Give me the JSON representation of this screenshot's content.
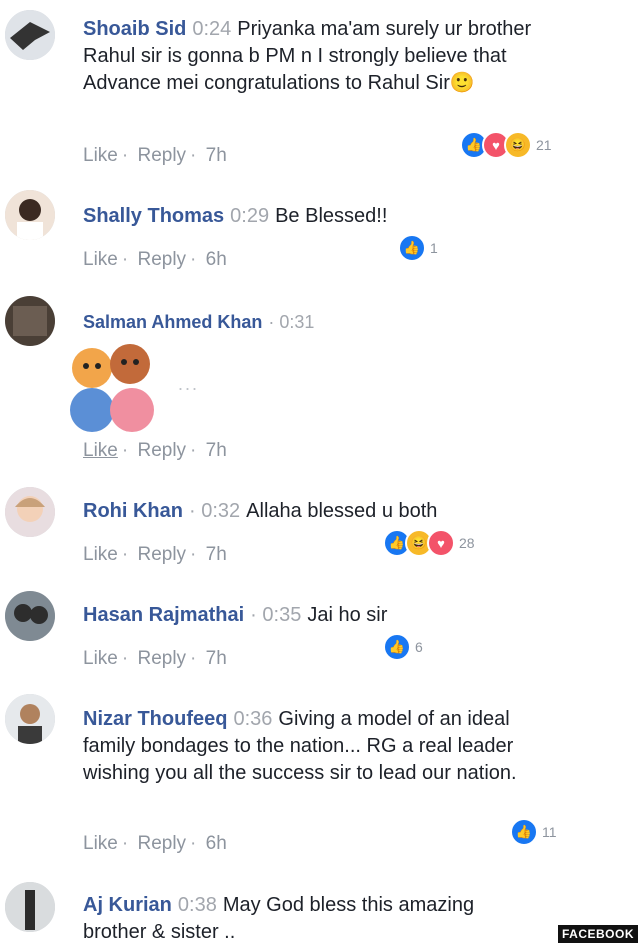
{
  "comments": [
    {
      "name": "Shoaib Sid",
      "time": "0:24",
      "text": "Priyanka ma'am surely ur brother Rahul sir is gonna b PM n I strongly believe that Advance mei congratulations to Rahul Sir🙂",
      "like": "Like",
      "reply": "Reply",
      "ago": "7h",
      "reaction_count": "21"
    },
    {
      "name": "Shally Thomas",
      "time": "0:29",
      "text": "Be Blessed!!",
      "like": "Like",
      "reply": "Reply",
      "ago": "6h",
      "reaction_count": "1"
    },
    {
      "name": "Salman Ahmed Khan",
      "time": "0:31",
      "text": "",
      "like": "Like",
      "reply": "Reply",
      "ago": "7h",
      "reaction_count": ""
    },
    {
      "name": "Rohi Khan",
      "time": "0:32",
      "text": "Allaha blessed u both",
      "like": "Like",
      "reply": "Reply",
      "ago": "7h",
      "reaction_count": "28"
    },
    {
      "name": "Hasan Rajmathai",
      "time": "0:35",
      "text": "Jai ho sir",
      "like": "Like",
      "reply": "Reply",
      "ago": "7h",
      "reaction_count": "6"
    },
    {
      "name": "Nizar Thoufeeq",
      "time": "0:36",
      "text": "Giving a model of an ideal family bondages to the nation... RG a real leader wishing you all the success sir to lead our nation.",
      "like": "Like",
      "reply": "Reply",
      "ago": "6h",
      "reaction_count": "11"
    },
    {
      "name": "Aj Kurian",
      "time": "0:38",
      "text": "May God bless this amazing brother & sister ..",
      "like": "",
      "reply": "",
      "ago": "",
      "reaction_count": ""
    }
  ],
  "separator": "·",
  "sticker_dots": "...",
  "watermark": "FACEBOOK",
  "colors": {
    "name": "#385898",
    "meta": "#8d949e",
    "like_blue": "#1877f2",
    "laugh": "#f7b928",
    "wow": "#f35369"
  }
}
